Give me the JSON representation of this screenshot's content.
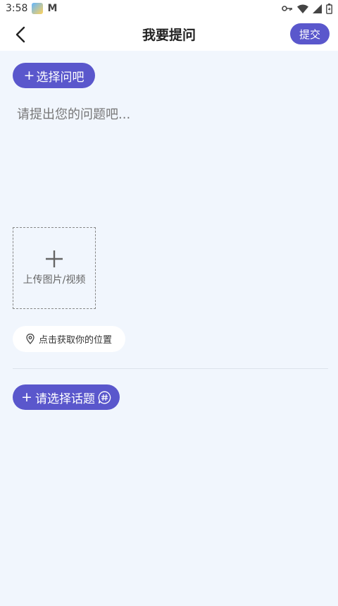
{
  "status_bar": {
    "time": "3:58",
    "mail_glyph": "M",
    "icons": [
      "weather-app-icon",
      "mail-app-icon",
      "vpn-key-icon",
      "wifi-icon",
      "signal-icon",
      "battery-icon"
    ]
  },
  "header": {
    "title": "我要提问",
    "submit_label": "提交",
    "back_icon": "back-arrow-icon"
  },
  "compose": {
    "choose_bar_label": "选择问吧",
    "question_placeholder": "请提出您的问题吧...",
    "upload_label": "上传图片/视频",
    "location_label": "点击获取你的位置",
    "topic_label": "请选择话题"
  },
  "colors": {
    "accent": "#5a57cc",
    "background": "#f1f6fd",
    "card": "#ffffff"
  }
}
